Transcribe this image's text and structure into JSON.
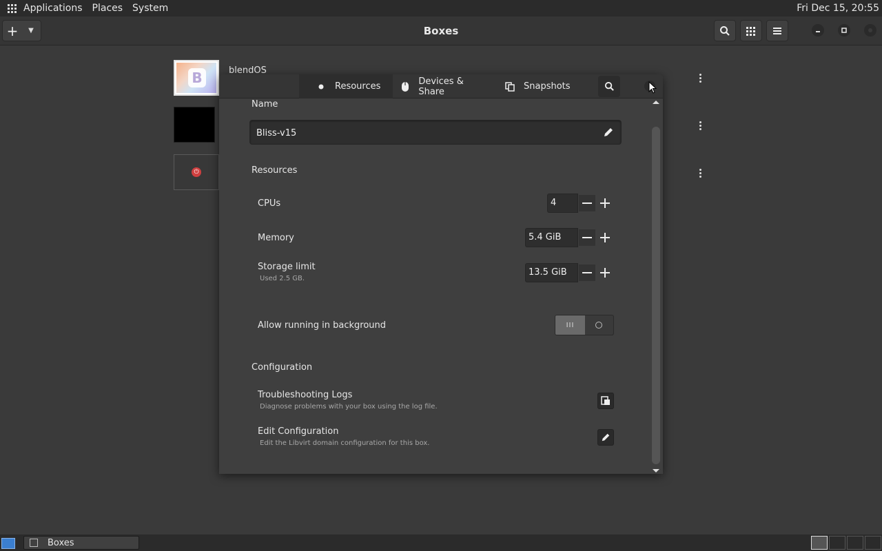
{
  "top_panel": {
    "menus": [
      "Applications",
      "Places",
      "System"
    ],
    "clock": "Fri Dec 15, 20:55"
  },
  "headerbar": {
    "title": "Boxes"
  },
  "boxes": [
    {
      "name": "blendOS"
    }
  ],
  "dialog": {
    "tabs": {
      "resources": "Resources",
      "devices": "Devices & Share",
      "snapshots": "Snapshots"
    },
    "name_section": "Name",
    "name_value": "Bliss-v15",
    "resources_section": "Resources",
    "cpus": {
      "label": "CPUs",
      "value": "4"
    },
    "memory": {
      "label": "Memory",
      "value": "5.4 GiB"
    },
    "storage": {
      "label": "Storage limit",
      "sub": "Used 2.5 GB.",
      "value": "13.5 GiB"
    },
    "background": {
      "label": "Allow running in background",
      "on_glyph": "III"
    },
    "config_section": "Configuration",
    "logs": {
      "label": "Troubleshooting Logs",
      "sub": "Diagnose problems with your box using the log file."
    },
    "edit": {
      "label": "Edit Configuration",
      "sub": "Edit the Libvirt domain configuration for this box."
    }
  },
  "taskbar": {
    "task": "Boxes"
  }
}
